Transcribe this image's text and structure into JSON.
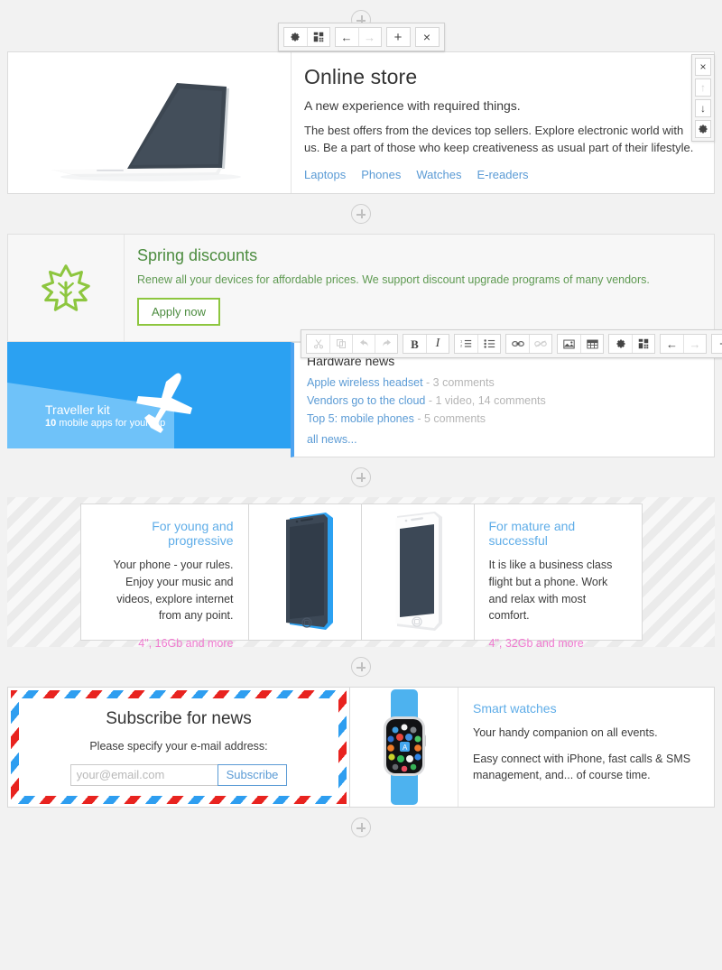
{
  "accent": {
    "link_blue": "#5b9bd5",
    "sky_blue": "#2ba1f2",
    "green": "#8dc63f",
    "green_text": "#4c8c3f",
    "pink": "#f07ad0",
    "select_blue": "#4da3f0"
  },
  "top_toolbar": {
    "buttons": [
      {
        "name": "settings",
        "icon": "gear-icon",
        "label": ""
      },
      {
        "name": "blocks",
        "icon": "blocks-icon",
        "label": ""
      },
      {
        "name": "move-up",
        "icon": "arrow-left-icon",
        "label": "←"
      },
      {
        "name": "move-down",
        "icon": "arrow-right-icon",
        "label": "→"
      },
      {
        "name": "add",
        "icon": "plus-icon",
        "label": "+"
      },
      {
        "name": "remove",
        "icon": "close-icon",
        "label": "×"
      }
    ]
  },
  "side_panel": {
    "buttons": [
      {
        "name": "close",
        "label": "×",
        "disabled": false
      },
      {
        "name": "move-up",
        "label": "↑",
        "disabled": true
      },
      {
        "name": "move-down",
        "label": "↓",
        "disabled": false
      },
      {
        "name": "settings",
        "label": "gear",
        "disabled": false
      }
    ]
  },
  "hero": {
    "title": "Online store",
    "subtitle": "A new experience with required things.",
    "text": "The best offers from the devices top sellers. Explore electronic world with us. Be a part of those who keep creativeness as usual part of their lifestyle.",
    "links": [
      "Laptops",
      "Phones",
      "Watches",
      "E-readers"
    ],
    "image_alt": "laptop-illustration"
  },
  "spring": {
    "title": "Spring discounts",
    "text": "Renew all your devices for affordable prices. We support discount upgrade programs of many vendors.",
    "button": "Apply now",
    "icon": "maple-leaf-icon"
  },
  "traveller": {
    "title": "Traveller kit",
    "count": "10",
    "subtitle": " mobile apps for your trip",
    "icon": "airplane-icon"
  },
  "news": {
    "title": "Hardware news",
    "items": [
      {
        "link": "Apple wireless headset",
        "meta": " - 3 comments"
      },
      {
        "link": "Vendors go to the cloud",
        "meta": " - 1 video, 14 comments"
      },
      {
        "link": "Top 5: mobile phones",
        "meta": " - 5 comments"
      }
    ],
    "all_news": "all news...",
    "toolbar": {
      "groups": [
        [
          {
            "name": "cut",
            "icon": "scissors-icon",
            "disabled": true
          },
          {
            "name": "copy",
            "icon": "copy-icon",
            "disabled": true
          },
          {
            "name": "undo",
            "icon": "undo-icon",
            "disabled": true
          },
          {
            "name": "redo",
            "icon": "redo-icon",
            "disabled": true
          }
        ],
        [
          {
            "name": "bold",
            "icon": "bold-icon",
            "label": "B",
            "disabled": false
          },
          {
            "name": "italic",
            "icon": "italic-icon",
            "label": "I",
            "disabled": false
          }
        ],
        [
          {
            "name": "ordered-list",
            "icon": "ordered-list-icon",
            "disabled": false
          },
          {
            "name": "unordered-list",
            "icon": "bullet-list-icon",
            "disabled": false
          }
        ],
        [
          {
            "name": "link",
            "icon": "link-icon",
            "disabled": false
          },
          {
            "name": "unlink",
            "icon": "unlink-icon",
            "disabled": true
          }
        ],
        [
          {
            "name": "image",
            "icon": "image-icon",
            "disabled": false
          },
          {
            "name": "table",
            "icon": "table-icon",
            "disabled": false
          }
        ],
        [
          {
            "name": "settings",
            "icon": "gear-icon",
            "disabled": false
          },
          {
            "name": "blocks",
            "icon": "blocks-icon",
            "disabled": false
          }
        ],
        [
          {
            "name": "move-up",
            "icon": "arrow-left-icon",
            "label": "←",
            "disabled": false
          },
          {
            "name": "move-down",
            "icon": "arrow-right-icon",
            "label": "→",
            "disabled": true
          }
        ],
        [
          {
            "name": "add",
            "icon": "plus-icon",
            "label": "+",
            "disabled": false
          }
        ],
        [
          {
            "name": "remove",
            "icon": "close-icon",
            "label": "×",
            "disabled": false
          }
        ]
      ]
    }
  },
  "phones": {
    "left": {
      "title": "For young and progressive",
      "text": "Your phone - your rules. Enjoy your music and videos, explore internet from any point.",
      "spec": "4\", 16Gb and more",
      "image_alt": "blue-phone-illustration"
    },
    "right": {
      "title": "For mature and successful",
      "text": "It is like a business class flight but a phone. Work and relax with most comfort.",
      "spec": "4\", 32Gb and more",
      "image_alt": "white-phone-illustration"
    }
  },
  "subscribe": {
    "title": "Subscribe for news",
    "hint": "Please specify your e-mail address:",
    "placeholder": "your@email.com",
    "value": "",
    "button": "Subscribe"
  },
  "watches": {
    "title": "Smart watches",
    "text1": "Your handy companion on all events.",
    "text2": "Easy connect with iPhone, fast calls & SMS management, and... of course time.",
    "image_alt": "smart-watch-illustration"
  }
}
